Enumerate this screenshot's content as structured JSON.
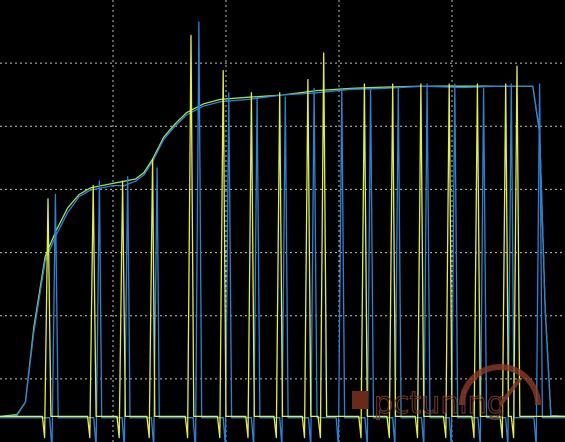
{
  "chart_data": {
    "type": "line",
    "title": "",
    "xlabel": "",
    "ylabel": "",
    "grid": true,
    "xlim": [
      0,
      100
    ],
    "ylim": [
      0,
      100
    ],
    "grid_divisions": {
      "x": 5,
      "y": 7
    },
    "colors": {
      "background": "#000000",
      "grid": "#bfbfbf",
      "series_green": "#9be25a",
      "series_blue": "#2a82d8",
      "series_yellow": "#e5ef3a",
      "watermark": "#8a3a28"
    },
    "series": [
      {
        "color_key": "series_green",
        "points": [
          [
            0,
            5.8
          ],
          [
            3,
            6.2
          ],
          [
            4.5,
            9
          ],
          [
            6,
            26
          ],
          [
            8,
            42
          ],
          [
            10,
            48
          ],
          [
            12,
            53
          ],
          [
            14,
            56
          ],
          [
            16,
            57.5
          ],
          [
            18,
            58
          ],
          [
            20,
            58.5
          ],
          [
            22,
            59
          ],
          [
            24,
            59.5
          ],
          [
            25.5,
            61
          ],
          [
            27,
            64
          ],
          [
            29,
            69
          ],
          [
            31,
            72
          ],
          [
            33,
            74.5
          ],
          [
            36,
            76.5
          ],
          [
            39,
            77.5
          ],
          [
            44,
            78
          ],
          [
            50,
            78.5
          ],
          [
            56,
            79.5
          ],
          [
            62,
            80
          ],
          [
            68,
            80.3
          ],
          [
            75,
            80.5
          ],
          [
            82,
            80.5
          ],
          [
            88,
            80.5
          ],
          [
            94.3,
            80.5
          ],
          [
            95.5,
            70
          ],
          [
            96.5,
            30
          ],
          [
            97.5,
            6
          ],
          [
            100,
            5.8
          ]
        ]
      },
      {
        "color_key": "series_blue",
        "points": [
          [
            0,
            5.6
          ],
          [
            3,
            6
          ],
          [
            4.5,
            9
          ],
          [
            6,
            25
          ],
          [
            8,
            41
          ],
          [
            10,
            47
          ],
          [
            12,
            52
          ],
          [
            14,
            55.5
          ],
          [
            16,
            57
          ],
          [
            18,
            57.5
          ],
          [
            20,
            58
          ],
          [
            22,
            58
          ],
          [
            24,
            59
          ],
          [
            25.5,
            60.5
          ],
          [
            27,
            63.5
          ],
          [
            29,
            68.5
          ],
          [
            31,
            71.5
          ],
          [
            33,
            74
          ],
          [
            36,
            76
          ],
          [
            39,
            77
          ],
          [
            44,
            77.5
          ],
          [
            50,
            78.5
          ],
          [
            56,
            79
          ],
          [
            62,
            79.8
          ],
          [
            68,
            80
          ],
          [
            75,
            80.5
          ],
          [
            82,
            80.2
          ],
          [
            88,
            80.5
          ],
          [
            94.3,
            80.5
          ],
          [
            95.5,
            70
          ],
          [
            96.5,
            30
          ],
          [
            97.5,
            6
          ],
          [
            100,
            5.6
          ]
        ]
      },
      {
        "color_key": "series_blue",
        "points": [
          [
            0,
            5.5
          ],
          [
            8.8,
            5.5
          ],
          [
            9.2,
            -2
          ],
          [
            9.8,
            56
          ],
          [
            10.3,
            5.5
          ],
          [
            16.6,
            5.5
          ],
          [
            17,
            -1.5
          ],
          [
            17.6,
            59
          ],
          [
            18,
            5.5
          ],
          [
            21.6,
            5.5
          ],
          [
            22,
            -1
          ],
          [
            22.6,
            60
          ],
          [
            23,
            5.5
          ],
          [
            26.8,
            5.5
          ],
          [
            27.2,
            -1
          ],
          [
            27.8,
            62
          ],
          [
            28.2,
            5.5
          ],
          [
            34.2,
            5.5
          ],
          [
            34.6,
            -2
          ],
          [
            35.2,
            95
          ],
          [
            35.7,
            5.5
          ],
          [
            39.5,
            5.5
          ],
          [
            39.9,
            -1
          ],
          [
            40.5,
            79
          ],
          [
            41,
            5.5
          ],
          [
            44.5,
            5.5
          ],
          [
            44.9,
            -1
          ],
          [
            45.5,
            78
          ],
          [
            46,
            5.5
          ],
          [
            49.5,
            5.5
          ],
          [
            49.9,
            -1
          ],
          [
            50.5,
            78
          ],
          [
            51,
            5.5
          ],
          [
            54.6,
            5.5
          ],
          [
            55,
            -1
          ],
          [
            55.6,
            80
          ],
          [
            56.1,
            5.5
          ],
          [
            59.5,
            5.5
          ],
          [
            59.9,
            -1
          ],
          [
            60.5,
            80
          ],
          [
            61,
            5.5
          ],
          [
            64.6,
            5.5
          ],
          [
            65,
            -1
          ],
          [
            65.6,
            80
          ],
          [
            66.1,
            5.5
          ],
          [
            69.5,
            5.5
          ],
          [
            69.9,
            -1
          ],
          [
            70.5,
            80
          ],
          [
            71,
            5.5
          ],
          [
            74.6,
            5.5
          ],
          [
            75,
            -1
          ],
          [
            75.6,
            81
          ],
          [
            76.1,
            5.5
          ],
          [
            79.5,
            5.5
          ],
          [
            79.9,
            -1
          ],
          [
            80.5,
            81
          ],
          [
            81,
            5.5
          ],
          [
            84.6,
            5.5
          ],
          [
            85,
            -1
          ],
          [
            85.6,
            80
          ],
          [
            86.1,
            5.5
          ],
          [
            89.5,
            5.5
          ],
          [
            89.9,
            -1
          ],
          [
            90.5,
            81
          ],
          [
            91,
            5.5
          ],
          [
            94.5,
            5.5
          ],
          [
            94.9,
            -1
          ],
          [
            95.5,
            81
          ],
          [
            96,
            5.5
          ],
          [
            100,
            5.5
          ]
        ]
      },
      {
        "color_key": "series_yellow",
        "points": [
          [
            0,
            5.8
          ],
          [
            7.5,
            5.8
          ],
          [
            7.9,
            1
          ],
          [
            8.5,
            55
          ],
          [
            9,
            5.8
          ],
          [
            15.5,
            5.8
          ],
          [
            15.9,
            1
          ],
          [
            16.5,
            58
          ],
          [
            17,
            5.8
          ],
          [
            20.7,
            5.8
          ],
          [
            21.1,
            1
          ],
          [
            21.7,
            59
          ],
          [
            22.2,
            5.8
          ],
          [
            26,
            5.8
          ],
          [
            26.4,
            1
          ],
          [
            27,
            64
          ],
          [
            27.4,
            5.8
          ],
          [
            32.8,
            5.8
          ],
          [
            33.2,
            1
          ],
          [
            33.8,
            92
          ],
          [
            34.3,
            5.8
          ],
          [
            38.5,
            5.8
          ],
          [
            38.9,
            1
          ],
          [
            39.5,
            84
          ],
          [
            40,
            5.8
          ],
          [
            43.5,
            5.8
          ],
          [
            43.9,
            1
          ],
          [
            44.5,
            79
          ],
          [
            45,
            5.8
          ],
          [
            48.5,
            5.8
          ],
          [
            48.9,
            1
          ],
          [
            49.5,
            79
          ],
          [
            50,
            5.8
          ],
          [
            53.5,
            5.8
          ],
          [
            53.9,
            1
          ],
          [
            54.5,
            82
          ],
          [
            55,
            5.8
          ],
          [
            56.3,
            5.8
          ],
          [
            56.7,
            1
          ],
          [
            57.3,
            88
          ],
          [
            57.8,
            5.8
          ],
          [
            63.5,
            5.8
          ],
          [
            63.9,
            1
          ],
          [
            64.5,
            81
          ],
          [
            65,
            5.8
          ],
          [
            68.5,
            5.8
          ],
          [
            68.9,
            1
          ],
          [
            69.5,
            81
          ],
          [
            70,
            5.8
          ],
          [
            73.5,
            5.8
          ],
          [
            73.9,
            1
          ],
          [
            74.5,
            81
          ],
          [
            75,
            5.8
          ],
          [
            78.5,
            5.8
          ],
          [
            78.9,
            1
          ],
          [
            79.5,
            81
          ],
          [
            80,
            5.8
          ],
          [
            83.5,
            5.8
          ],
          [
            83.9,
            1
          ],
          [
            84.5,
            81
          ],
          [
            85,
            5.8
          ],
          [
            88.5,
            5.8
          ],
          [
            88.9,
            1
          ],
          [
            89.5,
            81
          ],
          [
            90,
            5.8
          ],
          [
            90.5,
            5.8
          ],
          [
            90.9,
            1
          ],
          [
            91.5,
            85
          ],
          [
            92,
            5.8
          ],
          [
            100,
            5.8
          ]
        ]
      }
    ]
  },
  "watermark": {
    "text": "pctuning",
    "icon": "gauge-icon"
  }
}
